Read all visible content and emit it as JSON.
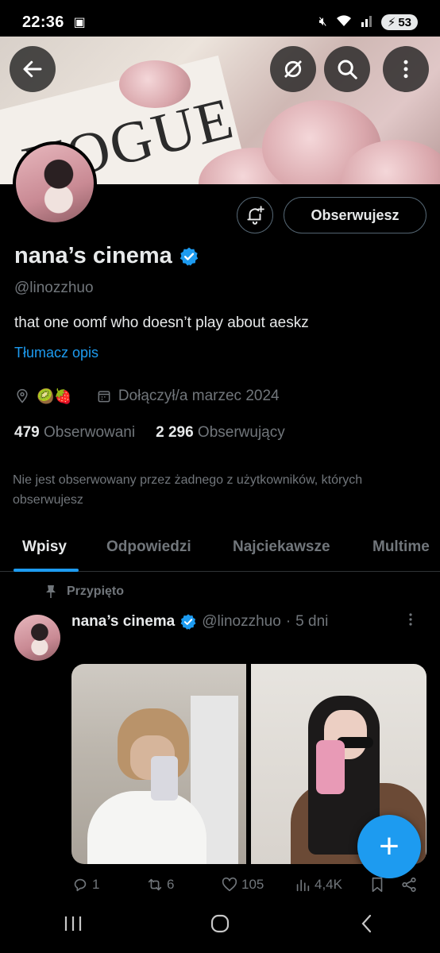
{
  "status_bar": {
    "time": "22:36",
    "battery": "53"
  },
  "profile": {
    "name": "nana’s cinema",
    "handle": "@linozzhuo",
    "bio": "that one oomf who doesn’t play about aeskz",
    "translate_label": "Tłumacz opis",
    "location_emojis": "🥝🍓",
    "joined": "Dołączył/a marzec 2024",
    "following_count": "479",
    "following_label": "Obserwowani",
    "followers_count": "2 296",
    "followers_label": "Obserwujący",
    "not_followed_note": "Nie jest obserwowany przez żadnego z użytkowników, których obserwujesz",
    "follow_button_label": "Obserwujesz",
    "verified_color": "#1d9bf0"
  },
  "banner": {
    "magazine_text": "VOGUE"
  },
  "tabs": [
    {
      "label": "Wpisy",
      "active": true
    },
    {
      "label": "Odpowiedzi",
      "active": false
    },
    {
      "label": "Najciekawsze",
      "active": false
    },
    {
      "label": "Multime",
      "active": false
    }
  ],
  "post": {
    "pinned_label": "Przypięto",
    "author_name": "nana’s cinema",
    "author_handle": "@linozzhuo",
    "separator": "·",
    "age": "5 dni",
    "replies": "1",
    "reposts": "6",
    "likes": "105",
    "views": "4,4K"
  },
  "colors": {
    "accent": "#1d9bf0",
    "background": "#000000",
    "muted_text": "#71767b",
    "primary_text": "#e7e9ea"
  }
}
